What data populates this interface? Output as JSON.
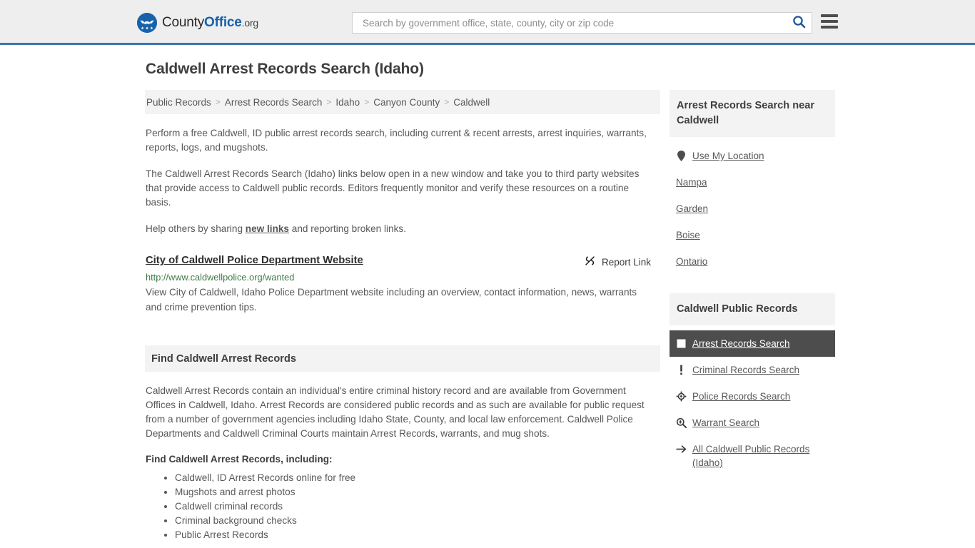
{
  "header": {
    "logo": {
      "icon": "eagle-seal-icon",
      "part1": "County",
      "part2": "Office",
      "part3": ".org"
    },
    "search": {
      "placeholder": "Search by government office, state, county, city or zip code",
      "value": "",
      "icon": "search-icon"
    },
    "menu_icon": "hamburger-menu-icon",
    "accent_color": "#3b77ad"
  },
  "main": {
    "title": "Caldwell Arrest Records Search (Idaho)",
    "breadcrumb": [
      "Public Records",
      "Arrest Records Search",
      "Idaho",
      "Canyon County",
      "Caldwell"
    ],
    "breadcrumb_separator": ">",
    "intro_paragraphs": [
      "Perform a free Caldwell, ID public arrest records search, including current & recent arrests, arrest inquiries, warrants, reports, logs, and mugshots.",
      "The Caldwell Arrest Records Search (Idaho) links below open in a new window and take you to third party websites that provide access to Caldwell public records. Editors frequently monitor and verify these resources on a routine basis."
    ],
    "help_line": {
      "before": "Help others by sharing ",
      "link": "new links",
      "after": " and reporting broken links."
    },
    "result": {
      "title": "City of Caldwell Police Department Website",
      "report_link_label": "Report Link",
      "report_link_icon": "broken-link-icon",
      "url": "http://www.caldwellpolice.org/wanted",
      "url_color": "#3d7a46",
      "description": "View City of Caldwell, Idaho Police Department website including an overview, contact information, news, warrants and crime prevention tips."
    },
    "section": {
      "heading": "Find Caldwell Arrest Records",
      "paragraph": "Caldwell Arrest Records contain an individual's entire criminal history record and are available from Government Offices in Caldwell, Idaho. Arrest Records are considered public records and as such are available for public request from a number of government agencies including Idaho State, County, and local law enforcement. Caldwell Police Departments and Caldwell Criminal Courts maintain Arrest Records, warrants, and mug shots.",
      "list_intro": "Find Caldwell Arrest Records, including:",
      "list_items": [
        "Caldwell, ID Arrest Records online for free",
        "Mugshots and arrest photos",
        "Caldwell criminal records",
        "Criminal background checks",
        "Public Arrest Records"
      ]
    }
  },
  "sidebar": {
    "nearby": {
      "heading": "Arrest Records Search near Caldwell",
      "items": [
        {
          "label": "Use My Location",
          "icon": "map-pin-icon"
        },
        {
          "label": "Nampa",
          "icon": "none"
        },
        {
          "label": "Garden",
          "icon": "none"
        },
        {
          "label": "Boise",
          "icon": "none"
        },
        {
          "label": "Ontario",
          "icon": "none"
        }
      ]
    },
    "public_records": {
      "heading": "Caldwell Public Records",
      "active_bg": "#4d4d4d",
      "items": [
        {
          "label": "Arrest Records Search",
          "icon": "document-square-icon",
          "active": true
        },
        {
          "label": "Criminal Records Search",
          "icon": "exclamation-icon",
          "active": false
        },
        {
          "label": "Police Records Search",
          "icon": "crosshair-badge-icon",
          "active": false
        },
        {
          "label": "Warrant Search",
          "icon": "magnifier-plus-icon",
          "active": false
        },
        {
          "label": "All Caldwell Public Records (Idaho)",
          "icon": "arrow-right-icon",
          "active": false
        }
      ]
    }
  }
}
